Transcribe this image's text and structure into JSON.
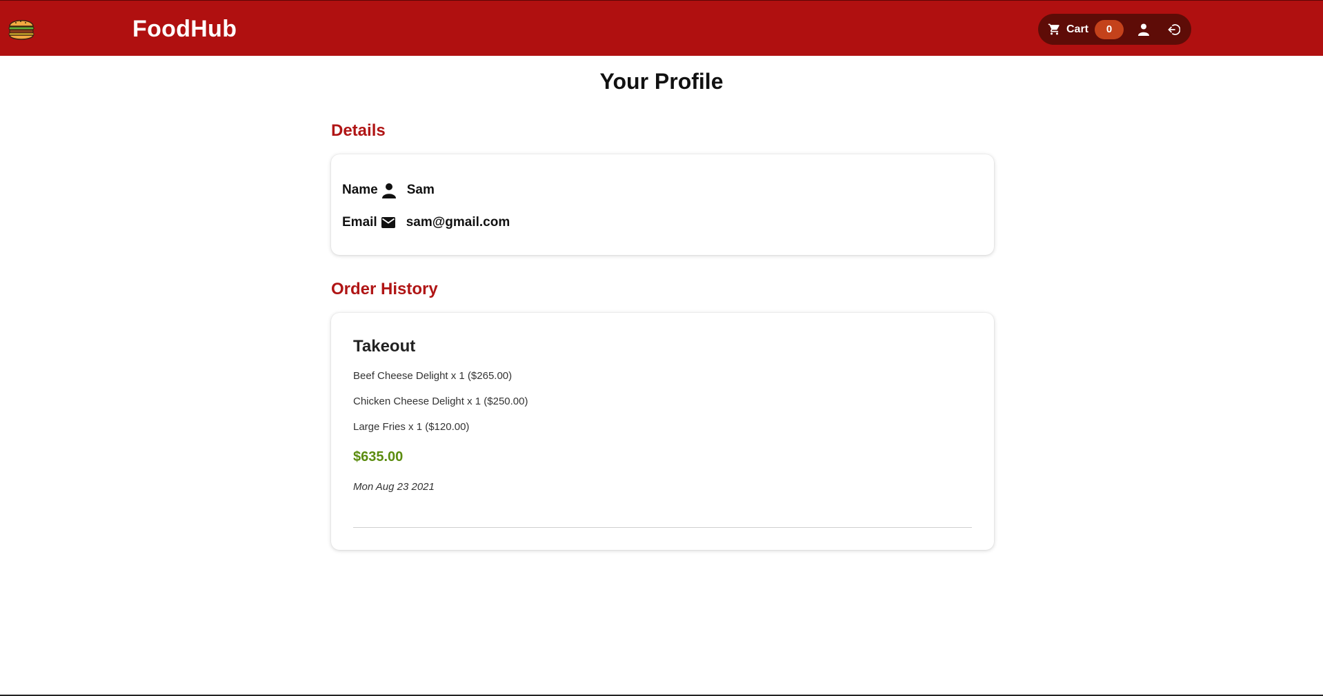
{
  "app": {
    "brand": "FoodHub",
    "logo_icon": "burger-icon",
    "accent_color": "#b01010"
  },
  "nav": {
    "cart_label": "Cart",
    "cart_count": "0",
    "cart_icon": "cart-icon",
    "user_icon": "user-icon",
    "logout_icon": "logout-icon"
  },
  "page": {
    "title": "Your Profile"
  },
  "details": {
    "heading": "Details",
    "name_label": "Name",
    "name_icon": "person-icon",
    "name_value": "Sam",
    "email_label": "Email",
    "email_icon": "envelope-icon",
    "email_value": "sam@gmail.com"
  },
  "order_history": {
    "heading": "Order History",
    "orders": [
      {
        "type": "Takeout",
        "items": [
          "Beef Cheese Delight x 1 ($265.00)",
          "Chicken Cheese Delight x 1 ($250.00)",
          "Large Fries x 1 ($120.00)"
        ],
        "total": "$635.00",
        "total_color": "#5b8c0f",
        "date": "Mon Aug 23 2021"
      }
    ]
  }
}
